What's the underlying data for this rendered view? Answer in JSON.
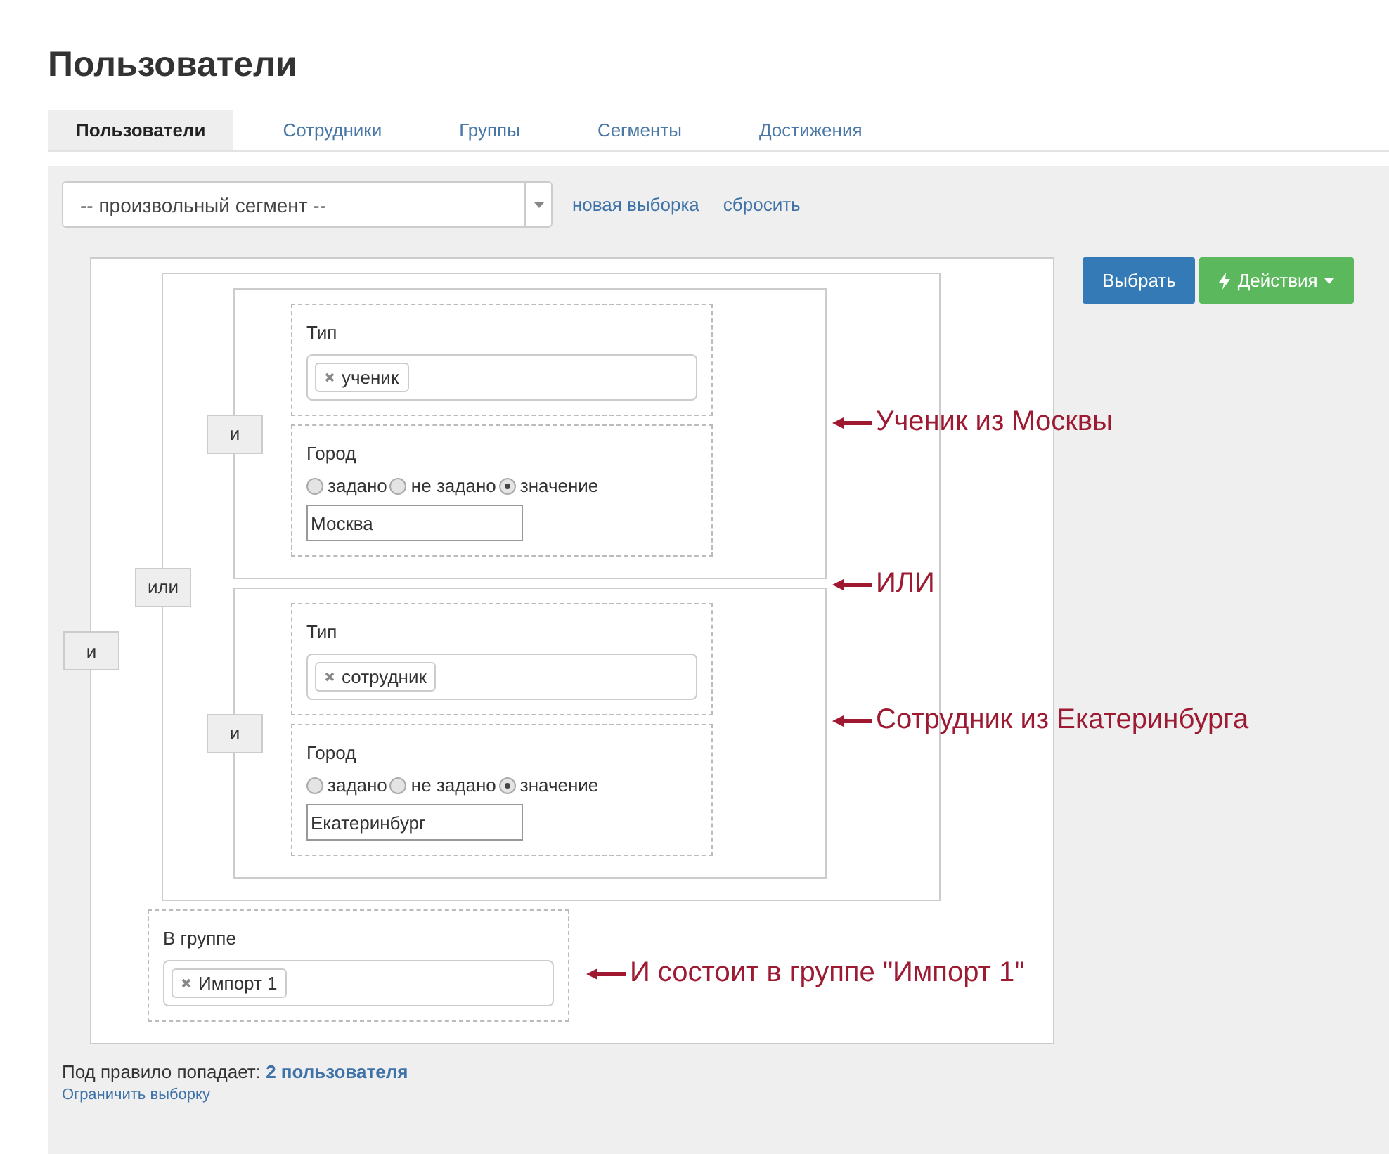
{
  "page_title": "Пользователи",
  "tabs": [
    {
      "label": "Пользователи",
      "selected": true
    },
    {
      "label": "Сотрудники",
      "selected": false
    },
    {
      "label": "Группы",
      "selected": false
    },
    {
      "label": "Сегменты",
      "selected": false
    },
    {
      "label": "Достижения",
      "selected": false
    }
  ],
  "segment_select": {
    "value": "-- произвольный сегмент --"
  },
  "links": [
    "новая выборка",
    "сбросить"
  ],
  "buttons": [
    {
      "label": "Выбрать",
      "kind": "primary"
    },
    {
      "label": "Действия",
      "kind": "actions"
    }
  ],
  "rule": {
    "kind": "group",
    "operator": "и",
    "children": [
      {
        "kind": "group",
        "operator": "или",
        "children": [
          {
            "kind": "group",
            "operator": "и",
            "children": [
              {
                "kind": "tags",
                "label": "Тип",
                "tags": [
                  "ученик"
                ]
              },
              {
                "kind": "radio",
                "label": "Город",
                "options": [
                  {
                    "label": "задано",
                    "selected": false
                  },
                  {
                    "label": "не задано",
                    "selected": false
                  },
                  {
                    "label": "значение",
                    "selected": true
                  }
                ],
                "value": "Москва"
              }
            ]
          },
          {
            "kind": "group",
            "operator": "и",
            "children": [
              {
                "kind": "tags",
                "label": "Тип",
                "tags": [
                  "сотрудник"
                ]
              },
              {
                "kind": "radio",
                "label": "Город",
                "options": [
                  {
                    "label": "задано",
                    "selected": false
                  },
                  {
                    "label": "не задано",
                    "selected": false
                  },
                  {
                    "label": "значение",
                    "selected": true
                  }
                ],
                "value": "Екатеринбург"
              }
            ]
          }
        ]
      },
      {
        "kind": "tags",
        "label": "В группе",
        "tags": [
          "Импорт 1"
        ]
      }
    ]
  },
  "annotations": [
    "Ученик из Москвы",
    "ИЛИ",
    "Сотрудник из Екатеринбурга",
    "И состоит в группе \"Импорт 1\""
  ],
  "summary": {
    "text": "Под правило попадает:",
    "count": "2 пользователя",
    "limit_link": "Ограничить выборку"
  }
}
